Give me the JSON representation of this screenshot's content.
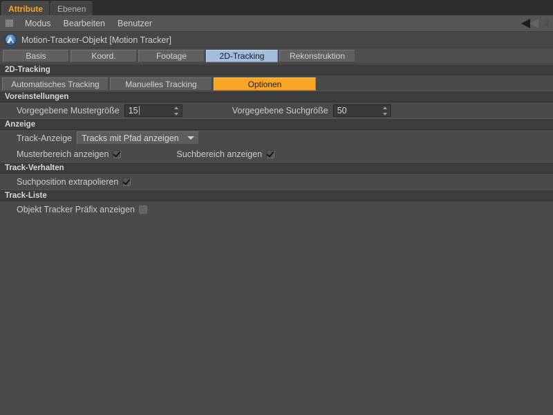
{
  "window": {
    "tabs": [
      {
        "label": "Attribute",
        "active": true
      },
      {
        "label": "Ebenen",
        "active": false
      }
    ]
  },
  "menubar": {
    "grip_icon": "grip-dots-icon",
    "items": [
      "Modus",
      "Bearbeiten",
      "Benutzer"
    ],
    "collapse_icon": "triangle-left-icon"
  },
  "object_header": {
    "icon": "motion-tracker-object-icon",
    "title": "Motion-Tracker-Objekt [Motion Tracker]"
  },
  "main_tabs": [
    {
      "label": "Basis",
      "active": false
    },
    {
      "label": "Koord.",
      "active": false
    },
    {
      "label": "Footage",
      "active": false
    },
    {
      "label": "2D-Tracking",
      "active": true
    },
    {
      "label": "Rekonstruktion",
      "active": false
    }
  ],
  "sections": {
    "tracking": {
      "header": "2D-Tracking",
      "buttons": [
        {
          "label": "Automatisches Tracking",
          "active": false
        },
        {
          "label": "Manuelles Tracking",
          "active": false
        },
        {
          "label": "Optionen",
          "active": true
        }
      ]
    },
    "voreinstellungen": {
      "header": "Voreinstellungen",
      "muster_label": "Vorgegebene Mustergröße",
      "muster_value": "15",
      "such_label": "Vorgegebene Suchgröße",
      "such_value": "50"
    },
    "anzeige": {
      "header": "Anzeige",
      "track_anzeige_label": "Track-Anzeige",
      "track_anzeige_value": "Tracks mit Pfad anzeigen",
      "musterbereich_label": "Musterbereich anzeigen",
      "musterbereich_checked": true,
      "suchbereich_label": "Suchbereich anzeigen",
      "suchbereich_checked": true
    },
    "track_verhalten": {
      "header": "Track-Verhalten",
      "extrapolieren_label": "Suchposition extrapolieren",
      "extrapolieren_checked": true
    },
    "track_liste": {
      "header": "Track-Liste",
      "praefix_label": "Objekt Tracker Präfix anzeigen",
      "praefix_checked": false
    }
  },
  "colors": {
    "accent_orange": "#f6a623",
    "tab_blue": "#a5bddd",
    "panel_bg": "#4a4a4a",
    "group_header_bg": "#3c3c3c"
  }
}
